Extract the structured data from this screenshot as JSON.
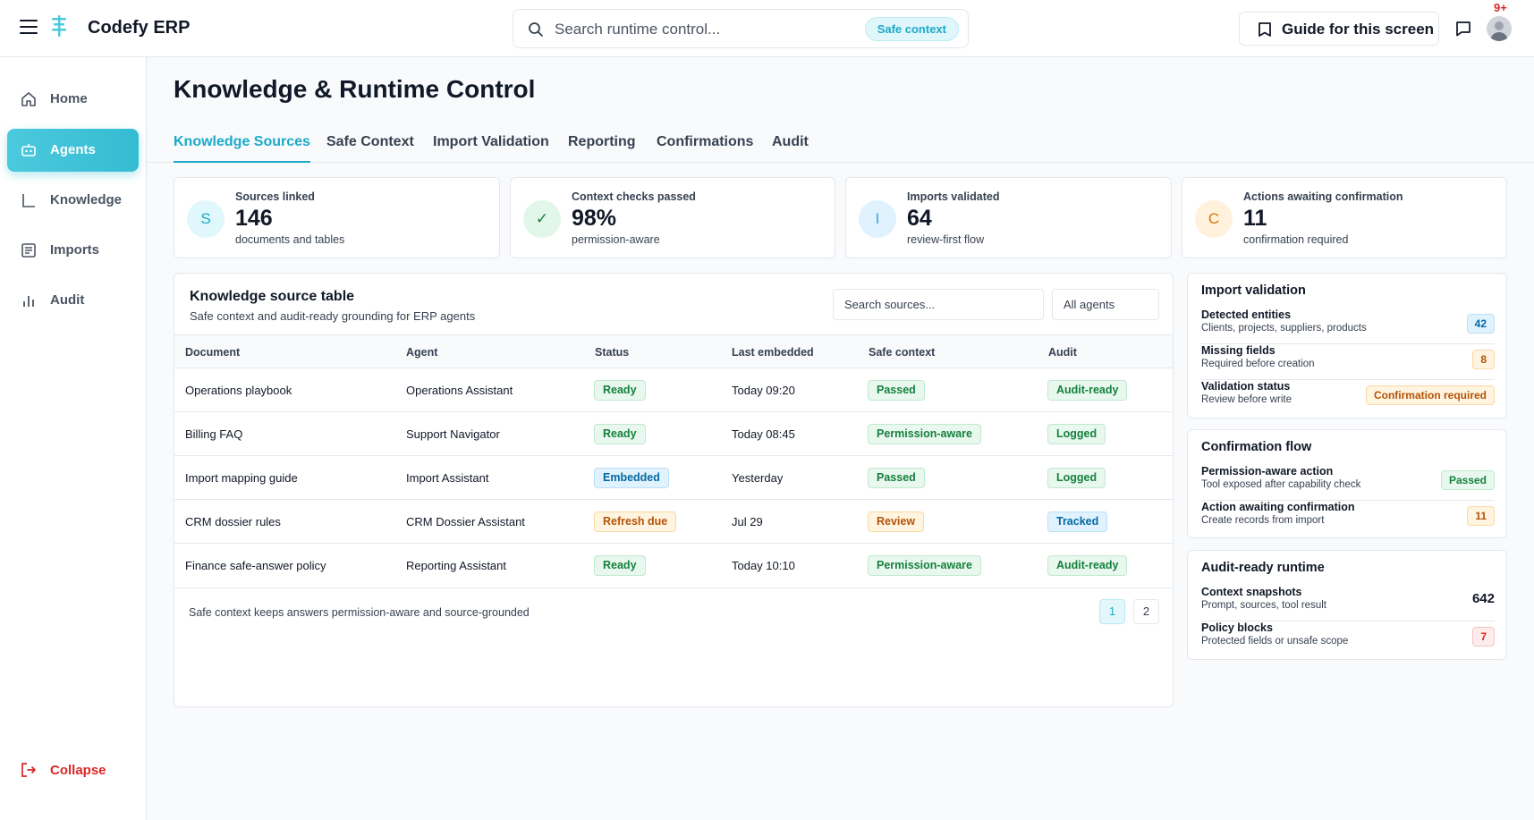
{
  "header": {
    "brand": "Codefy ERP",
    "search_placeholder": "Search runtime control...",
    "safe_context_pill": "Safe context",
    "guide_label": "Guide for this screen",
    "notification_count": "9+"
  },
  "sidebar": {
    "items": [
      {
        "label": "Home",
        "icon": "home-icon"
      },
      {
        "label": "Agents",
        "icon": "robot-icon"
      },
      {
        "label": "Knowledge",
        "icon": "knowledge-icon"
      },
      {
        "label": "Imports",
        "icon": "imports-icon"
      },
      {
        "label": "Audit",
        "icon": "bar-chart-icon"
      }
    ],
    "collapse_label": "Collapse"
  },
  "page": {
    "title": "Knowledge & Runtime Control",
    "tabs": [
      "Knowledge Sources",
      "Safe Context",
      "Import Validation",
      "Reporting",
      "Confirmations",
      "Audit"
    ]
  },
  "stats": [
    {
      "letter": "S",
      "label": "Sources linked",
      "value": "146",
      "sub": "documents and tables"
    },
    {
      "letter": "✓",
      "label": "Context checks passed",
      "value": "98%",
      "sub": "permission-aware"
    },
    {
      "letter": "I",
      "label": "Imports validated",
      "value": "64",
      "sub": "review-first flow"
    },
    {
      "letter": "C",
      "label": "Actions awaiting confirmation",
      "value": "11",
      "sub": "confirmation required"
    }
  ],
  "table": {
    "title": "Knowledge source table",
    "subtitle": "Safe context and audit-ready grounding for ERP agents",
    "search_placeholder": "Search sources...",
    "agent_filter": "All agents",
    "columns": [
      "Document",
      "Agent",
      "Status",
      "Last embedded",
      "Safe context",
      "Audit"
    ],
    "rows": [
      {
        "document": "Operations playbook",
        "agent": "Operations Assistant",
        "status": "Ready",
        "last_embedded": "Today 09:20",
        "safe_context": "Passed",
        "audit": "Audit-ready"
      },
      {
        "document": "Billing FAQ",
        "agent": "Support Navigator",
        "status": "Ready",
        "last_embedded": "Today 08:45",
        "safe_context": "Permission-aware",
        "audit": "Logged"
      },
      {
        "document": "Import mapping guide",
        "agent": "Import Assistant",
        "status": "Embedded",
        "last_embedded": "Yesterday",
        "safe_context": "Passed",
        "audit": "Logged"
      },
      {
        "document": "CRM dossier rules",
        "agent": "CRM Dossier Assistant",
        "status": "Refresh due",
        "last_embedded": "Jul 29",
        "safe_context": "Review",
        "audit": "Tracked"
      },
      {
        "document": "Finance safe-answer policy",
        "agent": "Reporting Assistant",
        "status": "Ready",
        "last_embedded": "Today 10:10",
        "safe_context": "Permission-aware",
        "audit": "Audit-ready"
      }
    ],
    "footer": "Safe context keeps answers permission-aware and source-grounded",
    "pages": [
      "1",
      "2"
    ]
  },
  "import_validation": {
    "title": "Import validation",
    "rows": [
      {
        "label": "Detected entities",
        "sub": "Clients, projects, suppliers, products",
        "badge": "42"
      },
      {
        "label": "Missing fields",
        "sub": "Required before creation",
        "badge": "8"
      },
      {
        "label": "Validation status",
        "sub": "Review before write",
        "badge": "Confirmation required"
      }
    ]
  },
  "confirmation_flow": {
    "title": "Confirmation flow",
    "rows": [
      {
        "label": "Permission-aware action",
        "sub": "Tool exposed after capability check",
        "badge": "Passed"
      },
      {
        "label": "Action awaiting confirmation",
        "sub": "Create records from import",
        "badge": "11"
      }
    ]
  },
  "audit_runtime": {
    "title": "Audit-ready runtime",
    "rows": [
      {
        "label": "Context snapshots",
        "sub": "Prompt, sources, tool result",
        "value": "642"
      },
      {
        "label": "Policy blocks",
        "sub": "Protected fields or unsafe scope",
        "badge": "7"
      }
    ]
  },
  "colors": {
    "accent": "#1ba9c7",
    "danger": "#dc2626",
    "success": "#15803d",
    "warning": "#b45309"
  }
}
